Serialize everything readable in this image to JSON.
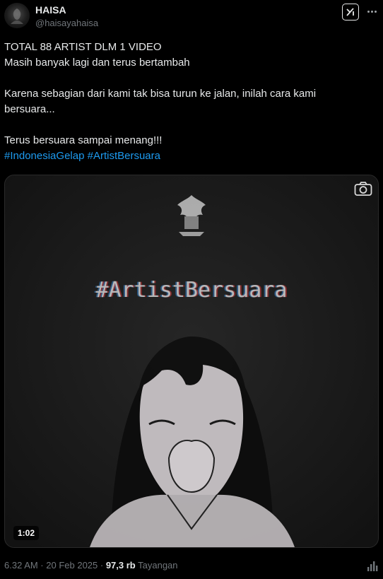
{
  "author": {
    "name": "HAISA",
    "handle": "@haisayahaisa"
  },
  "post": {
    "lines": [
      "TOTAL 88 ARTIST DLM 1 VIDEO",
      "Masih banyak lagi dan terus bertambah",
      "",
      "Karena sebagian dari kami tak bisa turun ke jalan, inilah cara kami",
      "bersuara...",
      "",
      "Terus bersuara sampai menang!!!"
    ],
    "hashtags": [
      "#IndonesiaGelap",
      "#ArtistBersuara"
    ]
  },
  "media": {
    "overlay_title": "#ArtistBersuara",
    "duration": "1:02"
  },
  "meta": {
    "timestamp": "6.32 AM · 20 Feb 2025 ·",
    "views_count": "97,3 rb",
    "views_label": "Tayangan"
  },
  "icons": {
    "grok": "grok-icon",
    "more": "more-icon",
    "camera": "camera-icon",
    "stats": "stats-icon"
  },
  "colors": {
    "background": "#000000",
    "text": "#e7e9ea",
    "muted": "#71767b",
    "link": "#1d9bf0"
  }
}
